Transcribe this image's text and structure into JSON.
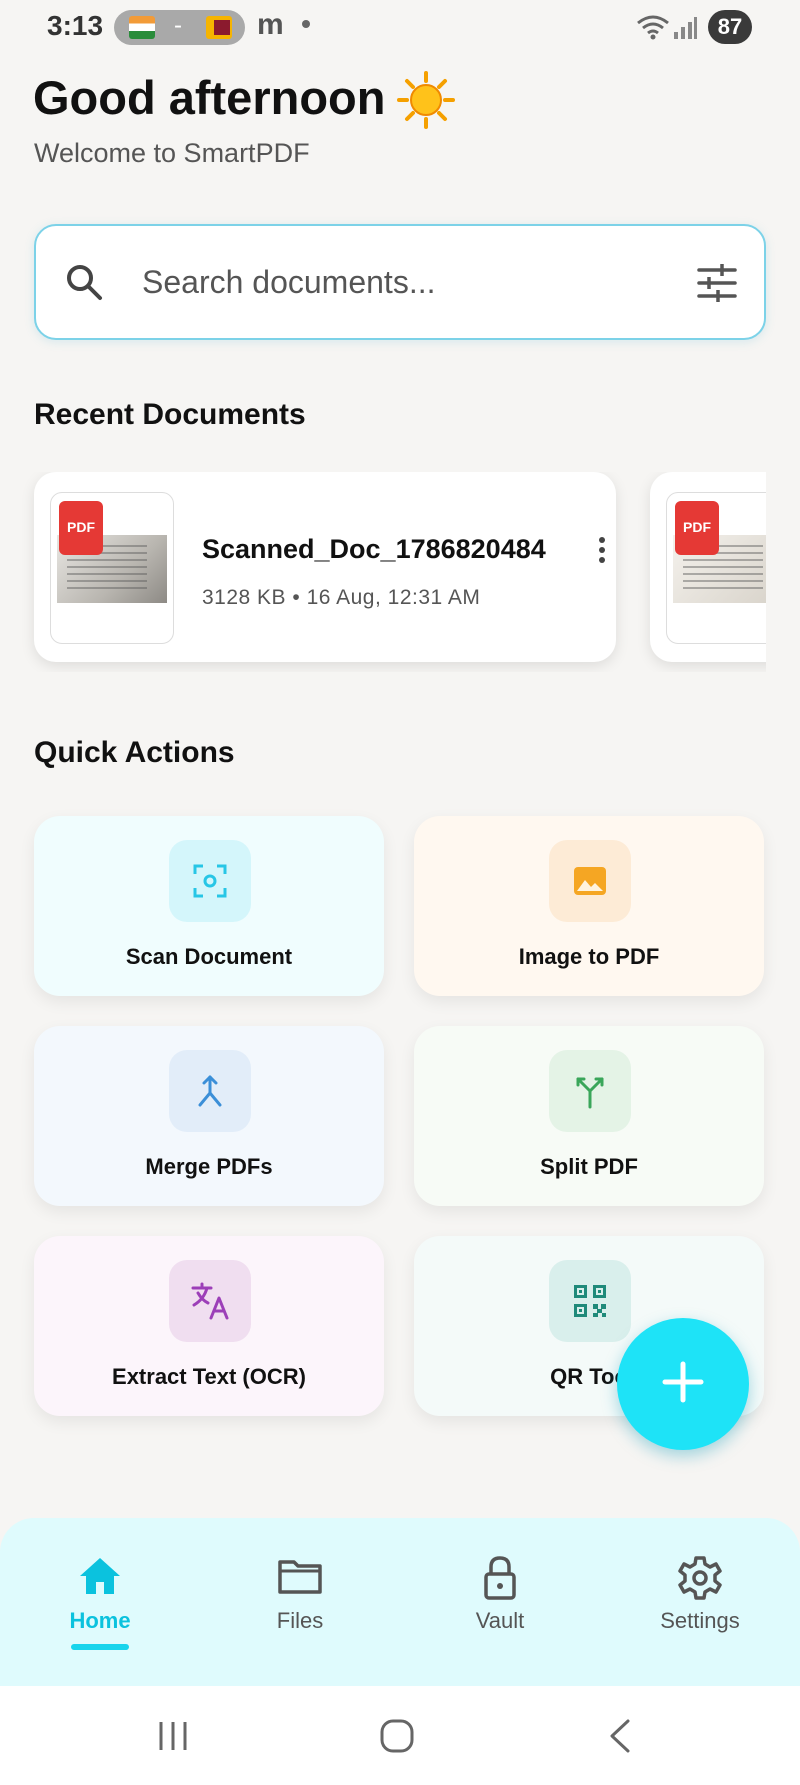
{
  "status": {
    "time": "3:13",
    "pill_text": "-",
    "letter": "m",
    "battery": "87"
  },
  "header": {
    "greeting": "Good afternoon",
    "subtitle": "Welcome to SmartPDF"
  },
  "search": {
    "placeholder": "Search documents..."
  },
  "recent": {
    "title": "Recent Documents",
    "documents": [
      {
        "badge": "PDF",
        "name": "Scanned_Doc_1786820484",
        "meta": "3128 KB • 16 Aug, 12:31 AM"
      },
      {
        "badge": "PDF"
      }
    ]
  },
  "quick_actions": {
    "title": "Quick Actions",
    "items": [
      {
        "label": "Scan Document",
        "icon": "scan-icon",
        "color": "#27c6e6"
      },
      {
        "label": "Image to PDF",
        "icon": "image-icon",
        "color": "#f5a623"
      },
      {
        "label": "Merge PDFs",
        "icon": "merge-icon",
        "color": "#3b8fd8"
      },
      {
        "label": "Split PDF",
        "icon": "split-icon",
        "color": "#3aa65a"
      },
      {
        "label": "Extract Text (OCR)",
        "icon": "translate-icon",
        "color": "#9c3fb8"
      },
      {
        "label": "QR Too",
        "icon": "qr-code-icon",
        "color": "#1f8a7a"
      }
    ]
  },
  "nav": {
    "items": [
      {
        "label": "Home",
        "icon": "home-icon",
        "active": true
      },
      {
        "label": "Files",
        "icon": "folder-icon"
      },
      {
        "label": "Vault",
        "icon": "lock-icon"
      },
      {
        "label": "Settings",
        "icon": "gear-icon"
      }
    ]
  },
  "colors": {
    "accent": "#1ee3f7",
    "pdf_badge": "#e53935",
    "nav_bg": "#dffbfd"
  }
}
